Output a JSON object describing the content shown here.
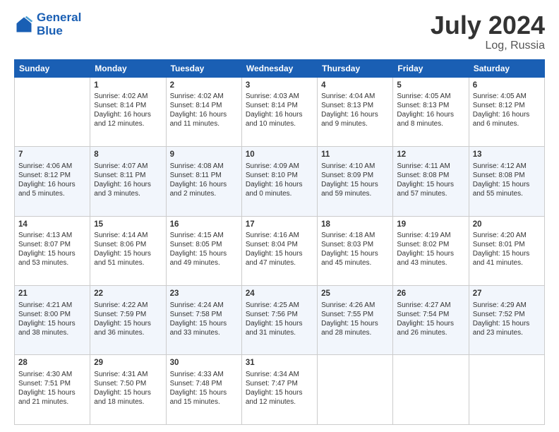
{
  "header": {
    "logo_line1": "General",
    "logo_line2": "Blue",
    "month": "July 2024",
    "location": "Log, Russia"
  },
  "weekdays": [
    "Sunday",
    "Monday",
    "Tuesday",
    "Wednesday",
    "Thursday",
    "Friday",
    "Saturday"
  ],
  "weeks": [
    [
      {
        "day": "",
        "sunrise": "",
        "sunset": "",
        "daylight": ""
      },
      {
        "day": "1",
        "sunrise": "Sunrise: 4:02 AM",
        "sunset": "Sunset: 8:14 PM",
        "daylight": "Daylight: 16 hours and 12 minutes."
      },
      {
        "day": "2",
        "sunrise": "Sunrise: 4:02 AM",
        "sunset": "Sunset: 8:14 PM",
        "daylight": "Daylight: 16 hours and 11 minutes."
      },
      {
        "day": "3",
        "sunrise": "Sunrise: 4:03 AM",
        "sunset": "Sunset: 8:14 PM",
        "daylight": "Daylight: 16 hours and 10 minutes."
      },
      {
        "day": "4",
        "sunrise": "Sunrise: 4:04 AM",
        "sunset": "Sunset: 8:13 PM",
        "daylight": "Daylight: 16 hours and 9 minutes."
      },
      {
        "day": "5",
        "sunrise": "Sunrise: 4:05 AM",
        "sunset": "Sunset: 8:13 PM",
        "daylight": "Daylight: 16 hours and 8 minutes."
      },
      {
        "day": "6",
        "sunrise": "Sunrise: 4:05 AM",
        "sunset": "Sunset: 8:12 PM",
        "daylight": "Daylight: 16 hours and 6 minutes."
      }
    ],
    [
      {
        "day": "7",
        "sunrise": "Sunrise: 4:06 AM",
        "sunset": "Sunset: 8:12 PM",
        "daylight": "Daylight: 16 hours and 5 minutes."
      },
      {
        "day": "8",
        "sunrise": "Sunrise: 4:07 AM",
        "sunset": "Sunset: 8:11 PM",
        "daylight": "Daylight: 16 hours and 3 minutes."
      },
      {
        "day": "9",
        "sunrise": "Sunrise: 4:08 AM",
        "sunset": "Sunset: 8:11 PM",
        "daylight": "Daylight: 16 hours and 2 minutes."
      },
      {
        "day": "10",
        "sunrise": "Sunrise: 4:09 AM",
        "sunset": "Sunset: 8:10 PM",
        "daylight": "Daylight: 16 hours and 0 minutes."
      },
      {
        "day": "11",
        "sunrise": "Sunrise: 4:10 AM",
        "sunset": "Sunset: 8:09 PM",
        "daylight": "Daylight: 15 hours and 59 minutes."
      },
      {
        "day": "12",
        "sunrise": "Sunrise: 4:11 AM",
        "sunset": "Sunset: 8:08 PM",
        "daylight": "Daylight: 15 hours and 57 minutes."
      },
      {
        "day": "13",
        "sunrise": "Sunrise: 4:12 AM",
        "sunset": "Sunset: 8:08 PM",
        "daylight": "Daylight: 15 hours and 55 minutes."
      }
    ],
    [
      {
        "day": "14",
        "sunrise": "Sunrise: 4:13 AM",
        "sunset": "Sunset: 8:07 PM",
        "daylight": "Daylight: 15 hours and 53 minutes."
      },
      {
        "day": "15",
        "sunrise": "Sunrise: 4:14 AM",
        "sunset": "Sunset: 8:06 PM",
        "daylight": "Daylight: 15 hours and 51 minutes."
      },
      {
        "day": "16",
        "sunrise": "Sunrise: 4:15 AM",
        "sunset": "Sunset: 8:05 PM",
        "daylight": "Daylight: 15 hours and 49 minutes."
      },
      {
        "day": "17",
        "sunrise": "Sunrise: 4:16 AM",
        "sunset": "Sunset: 8:04 PM",
        "daylight": "Daylight: 15 hours and 47 minutes."
      },
      {
        "day": "18",
        "sunrise": "Sunrise: 4:18 AM",
        "sunset": "Sunset: 8:03 PM",
        "daylight": "Daylight: 15 hours and 45 minutes."
      },
      {
        "day": "19",
        "sunrise": "Sunrise: 4:19 AM",
        "sunset": "Sunset: 8:02 PM",
        "daylight": "Daylight: 15 hours and 43 minutes."
      },
      {
        "day": "20",
        "sunrise": "Sunrise: 4:20 AM",
        "sunset": "Sunset: 8:01 PM",
        "daylight": "Daylight: 15 hours and 41 minutes."
      }
    ],
    [
      {
        "day": "21",
        "sunrise": "Sunrise: 4:21 AM",
        "sunset": "Sunset: 8:00 PM",
        "daylight": "Daylight: 15 hours and 38 minutes."
      },
      {
        "day": "22",
        "sunrise": "Sunrise: 4:22 AM",
        "sunset": "Sunset: 7:59 PM",
        "daylight": "Daylight: 15 hours and 36 minutes."
      },
      {
        "day": "23",
        "sunrise": "Sunrise: 4:24 AM",
        "sunset": "Sunset: 7:58 PM",
        "daylight": "Daylight: 15 hours and 33 minutes."
      },
      {
        "day": "24",
        "sunrise": "Sunrise: 4:25 AM",
        "sunset": "Sunset: 7:56 PM",
        "daylight": "Daylight: 15 hours and 31 minutes."
      },
      {
        "day": "25",
        "sunrise": "Sunrise: 4:26 AM",
        "sunset": "Sunset: 7:55 PM",
        "daylight": "Daylight: 15 hours and 28 minutes."
      },
      {
        "day": "26",
        "sunrise": "Sunrise: 4:27 AM",
        "sunset": "Sunset: 7:54 PM",
        "daylight": "Daylight: 15 hours and 26 minutes."
      },
      {
        "day": "27",
        "sunrise": "Sunrise: 4:29 AM",
        "sunset": "Sunset: 7:52 PM",
        "daylight": "Daylight: 15 hours and 23 minutes."
      }
    ],
    [
      {
        "day": "28",
        "sunrise": "Sunrise: 4:30 AM",
        "sunset": "Sunset: 7:51 PM",
        "daylight": "Daylight: 15 hours and 21 minutes."
      },
      {
        "day": "29",
        "sunrise": "Sunrise: 4:31 AM",
        "sunset": "Sunset: 7:50 PM",
        "daylight": "Daylight: 15 hours and 18 minutes."
      },
      {
        "day": "30",
        "sunrise": "Sunrise: 4:33 AM",
        "sunset": "Sunset: 7:48 PM",
        "daylight": "Daylight: 15 hours and 15 minutes."
      },
      {
        "day": "31",
        "sunrise": "Sunrise: 4:34 AM",
        "sunset": "Sunset: 7:47 PM",
        "daylight": "Daylight: 15 hours and 12 minutes."
      },
      {
        "day": "",
        "sunrise": "",
        "sunset": "",
        "daylight": ""
      },
      {
        "day": "",
        "sunrise": "",
        "sunset": "",
        "daylight": ""
      },
      {
        "day": "",
        "sunrise": "",
        "sunset": "",
        "daylight": ""
      }
    ]
  ]
}
